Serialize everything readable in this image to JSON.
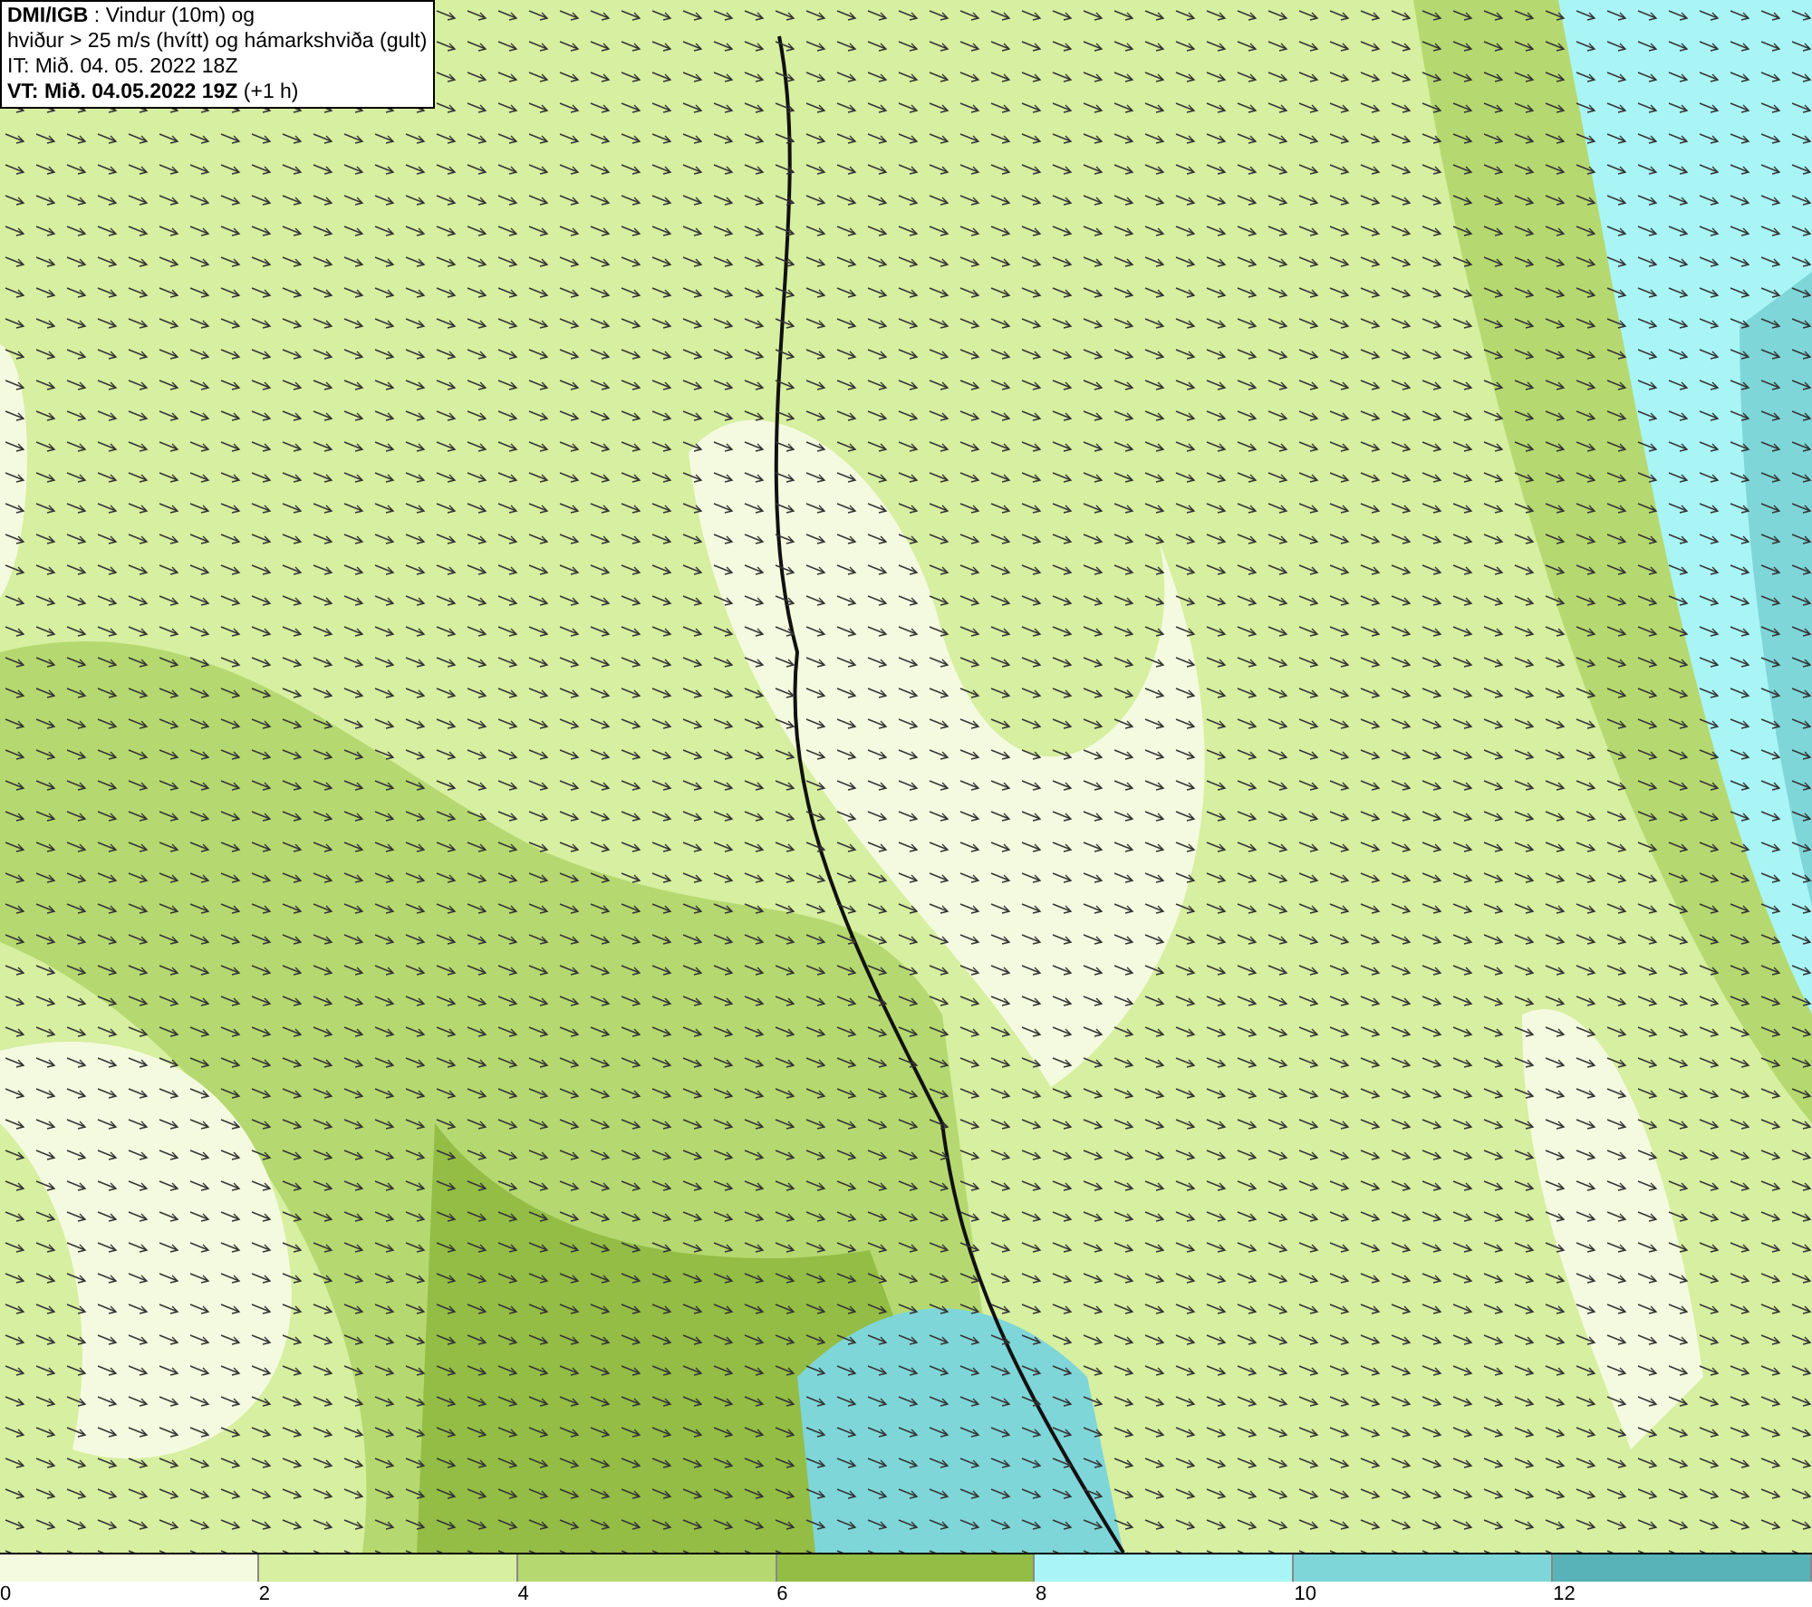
{
  "info_box": {
    "lines": [
      "**DMI/IGB** : Vindur (10m) og",
      "hviður > 25 m/s (hvítt) og hámarkshviða (gult)",
      "IT: Mið. 04. 05. 2022 18Z",
      "**VT: Mið. 04.05.2022 19Z** (+1 h)"
    ]
  },
  "colorbar": [
    {
      "label": "0",
      "color": "#f4fadf"
    },
    {
      "label": "2",
      "color": "#d6efa0"
    },
    {
      "label": "4",
      "color": "#b5d970"
    },
    {
      "label": "6",
      "color": "#93bd45"
    },
    {
      "label": "8",
      "color": "#a9f5f5"
    },
    {
      "label": "10",
      "color": "#7fd6d8"
    },
    {
      "label": "12",
      "color": "#57b3b7"
    }
  ]
}
